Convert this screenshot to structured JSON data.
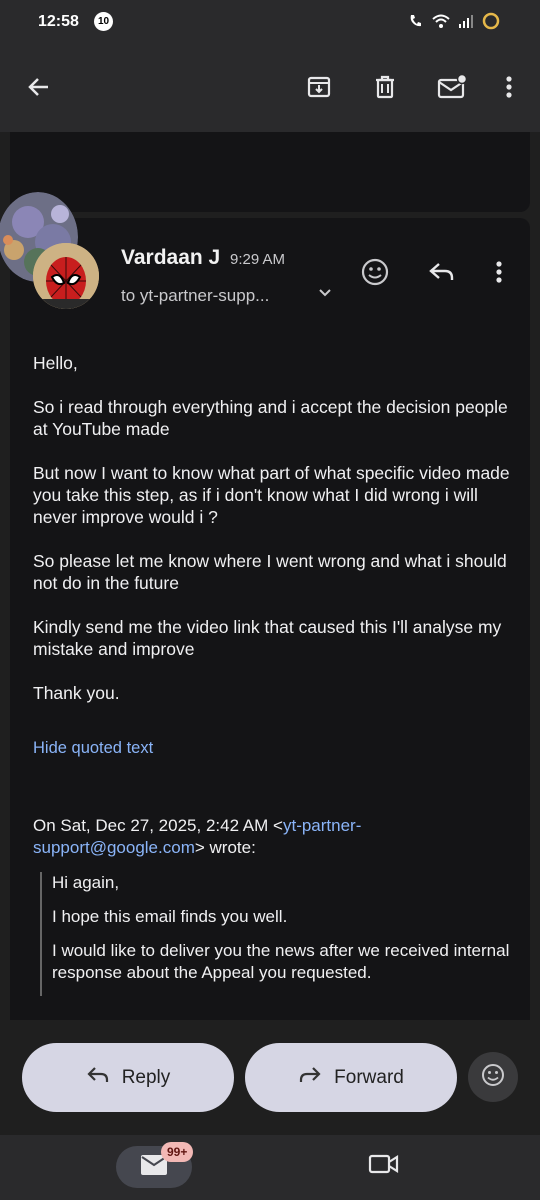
{
  "status_bar": {
    "time": "12:58",
    "notification_badge": "10"
  },
  "toolbar": {
    "back_icon": "arrow-left-icon",
    "archive_icon": "archive-icon",
    "delete_icon": "trash-icon",
    "unread_icon": "mail-unread-icon",
    "more_icon": "more-vert-icon"
  },
  "message": {
    "sender": "Vardaan J",
    "time": "9:29 AM",
    "recipient": "to yt-partner-supp...",
    "body": [
      "Hello,",
      "So i read through everything and i accept the decision people at YouTube made",
      "But now I want to know what part of what specific video made you take this step, as if i don't know what I did wrong i will never improve would i ?",
      "So please let me know where I went wrong and what i should not do in the future",
      "Kindly send me the video link that caused this I'll analyse my mistake and improve",
      "Thank you."
    ],
    "hide_quoted": "Hide quoted text",
    "quote_header_prefix": "On Sat, Dec 27, 2025, 2:42 AM <",
    "quote_header_email": "yt-partner-support@google.com",
    "quote_header_suffix": "> wrote:",
    "quoted": [
      "Hi again,",
      "I hope this email finds you well.",
      "I would like to deliver you the news after we received internal response about the Appeal you requested."
    ]
  },
  "actions": {
    "reply": "Reply",
    "forward": "Forward"
  },
  "bottom_nav": {
    "mail_count": "99+"
  },
  "colors": {
    "background": "#1f1f1f",
    "card": "#141416",
    "link": "#8ab4f8",
    "pill": "#d6d6e4"
  }
}
